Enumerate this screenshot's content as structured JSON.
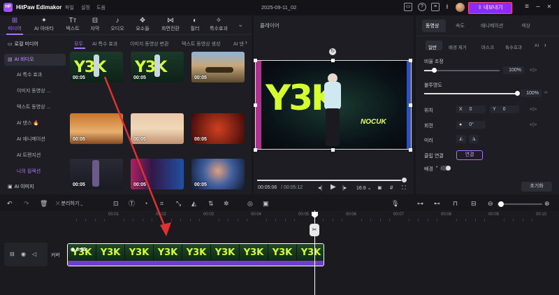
{
  "app": {
    "title": "HitPaw Edimakor",
    "logo": "HP",
    "menu": [
      "파일",
      "설정",
      "도움"
    ],
    "doc_title": "2025-09-11_02",
    "export_label": "내보내기"
  },
  "tool_tabs": [
    {
      "icon": "media-icon",
      "glyph": "⊞",
      "label": "미디어"
    },
    {
      "icon": "ai-tools-icon",
      "glyph": "✦",
      "label": "AI 아바타"
    },
    {
      "icon": "text-icon",
      "glyph": "Tт",
      "label": "텍스트"
    },
    {
      "icon": "subtitle-icon",
      "glyph": "⊟",
      "label": "자막"
    },
    {
      "icon": "audio-icon",
      "glyph": "♪",
      "label": "오디오"
    },
    {
      "icon": "elements-icon",
      "glyph": "❖",
      "label": "요소들"
    },
    {
      "icon": "transition-icon",
      "glyph": "⋈",
      "label": "화면전환"
    },
    {
      "icon": "filter-icon",
      "glyph": "◐",
      "label": "필터"
    },
    {
      "icon": "effects-icon",
      "glyph": "✧",
      "label": "특수효과"
    }
  ],
  "sidebar": [
    {
      "label": "로컬 미디어",
      "type": "sec",
      "glyph": "▭"
    },
    {
      "label": "AI 비디오",
      "type": "active",
      "glyph": "▤"
    },
    {
      "label": "AI 특수 효과",
      "type": "sub"
    },
    {
      "label": "이미지 동영상 ...",
      "type": "sub"
    },
    {
      "label": "텍스트 동영상 ...",
      "type": "sub"
    },
    {
      "label": "AI 댄스 🔥",
      "type": "sub"
    },
    {
      "label": "AI 애니메이션",
      "type": "sub"
    },
    {
      "label": "AI 트랜지션",
      "type": "sub"
    },
    {
      "label": "나의 컬렉션",
      "type": "fav"
    },
    {
      "label": "AI 이미지",
      "type": "sec",
      "glyph": "▣"
    }
  ],
  "sub_tabs": [
    "모두",
    "AI 특수 효과",
    "이미지 동영상 변환",
    "텍스트 동영상 생성",
    "AI 댄"
  ],
  "thumbnails": [
    {
      "duration": "00:05",
      "kind": "y3k"
    },
    {
      "duration": "00:05",
      "kind": "y3k"
    },
    {
      "duration": "00:05",
      "kind": "road"
    },
    {
      "duration": "00:05",
      "kind": "bedroom"
    },
    {
      "duration": "00:05",
      "kind": "sky"
    },
    {
      "duration": "00:05",
      "kind": "redroom"
    },
    {
      "duration": "00:05",
      "kind": "dark"
    },
    {
      "duration": "00:05",
      "kind": "neon"
    },
    {
      "duration": "00:05",
      "kind": "portrait"
    }
  ],
  "player": {
    "label": "플레이어",
    "current_time": "00:05:06",
    "total_time": "/ 00:05:12",
    "aspect": "16:9",
    "logo_text": "Y3K",
    "subtext": "NOCUK",
    "progress": 0.98
  },
  "props": {
    "tabs": [
      "동영상",
      "속도",
      "애니메이션",
      "색상"
    ],
    "sub_tabs": [
      "일반",
      "배경 제거",
      "마스크",
      "특수효과",
      "AI"
    ],
    "scale_label": "비율 조정",
    "scale_value": "100%",
    "opacity_label": "불투명도",
    "opacity_value": "100%",
    "position_label": "위치",
    "pos_x_label": "X",
    "pos_x": "0",
    "pos_y_label": "Y",
    "pos_y": "0",
    "rotate_label": "회전",
    "rotate_value": "0°",
    "mirror_label": "미러",
    "clip_link_label": "클립 연결",
    "connect_label": "연결",
    "background_label": "배경",
    "reset_label": "초기화",
    "scale_fraction": 0.1,
    "opacity_fraction": 1.0
  },
  "timeline_toolbar": {
    "split_label": "분리하기"
  },
  "timeline": {
    "ticks": [
      "00:00",
      "00:01",
      "00:02",
      "00:03",
      "00:04",
      "00:05",
      "00:06",
      "00:07",
      "00:08",
      "00:09",
      "00:10"
    ],
    "track_label": "커버",
    "clip_duration": "0:05"
  }
}
